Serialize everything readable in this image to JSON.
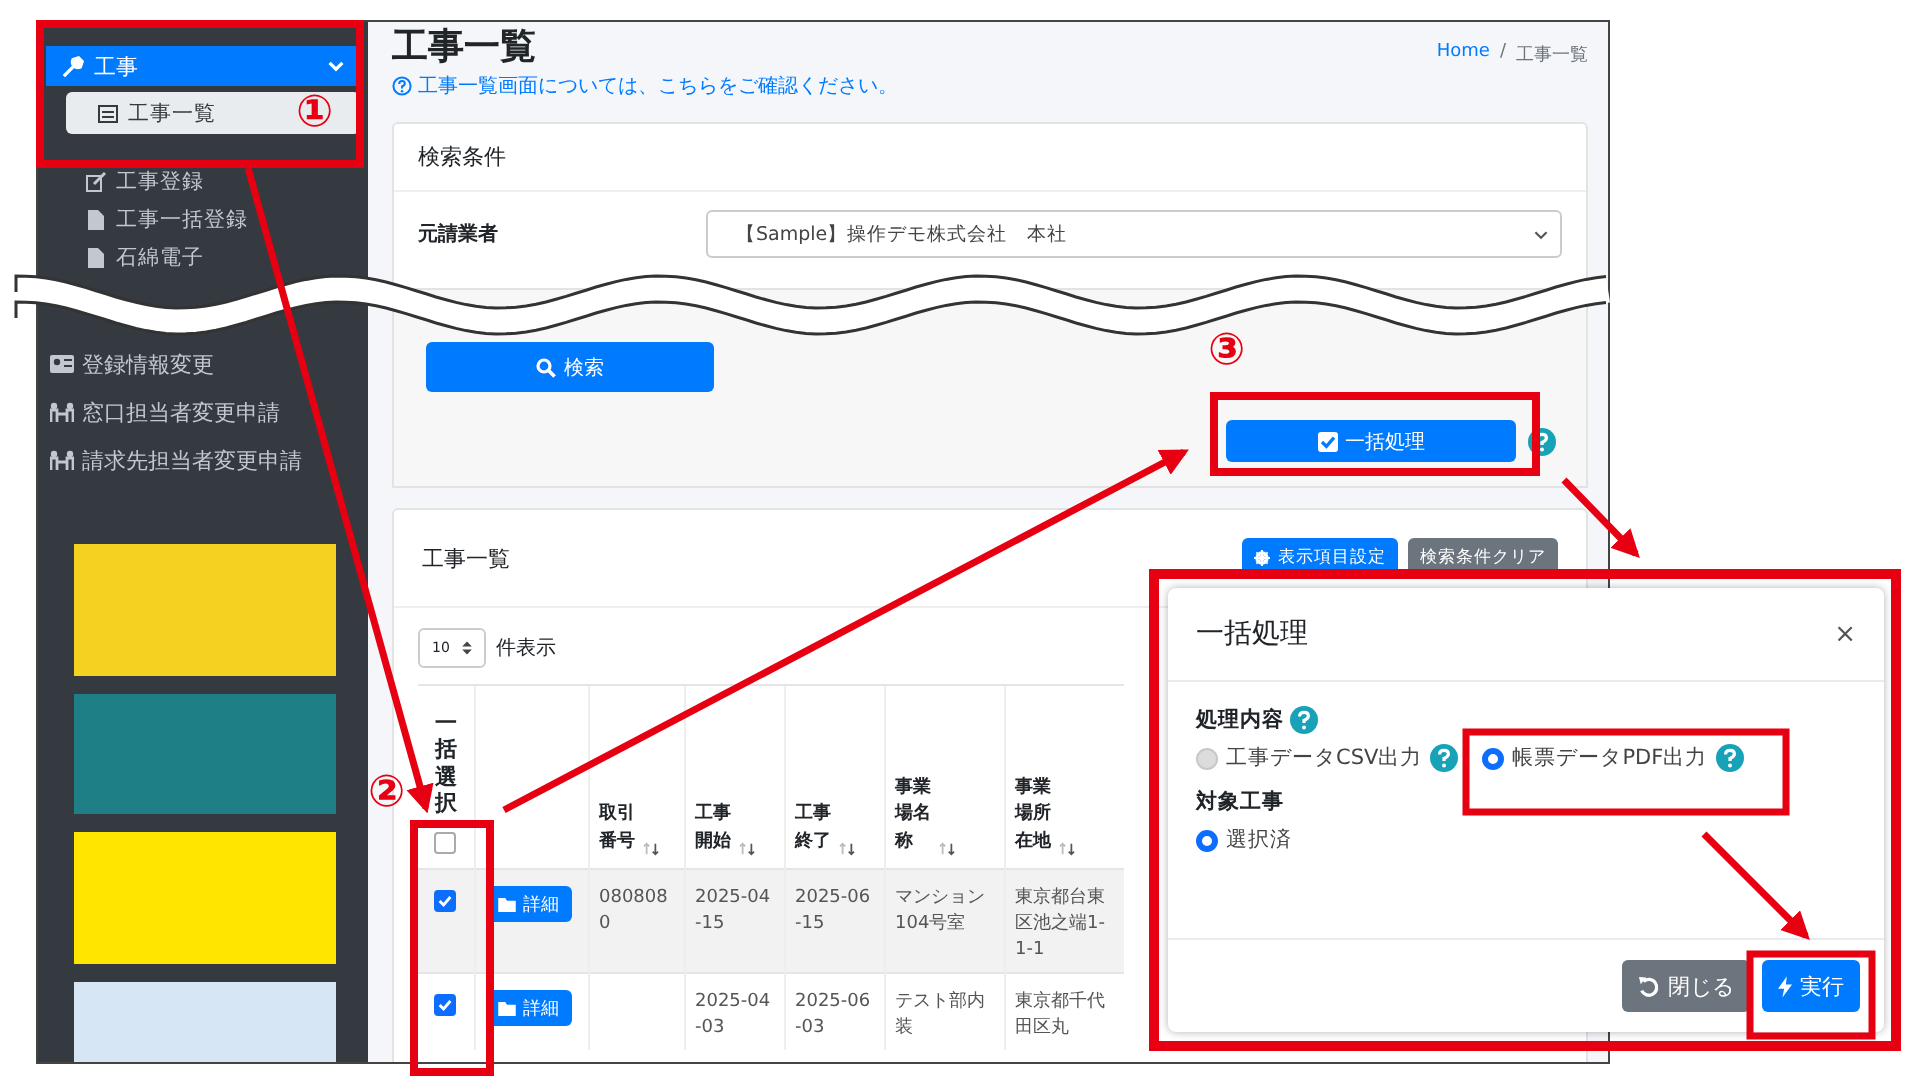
{
  "sidebar": {
    "section": {
      "label": "工事",
      "expanded": true
    },
    "sub_items": [
      {
        "label": "工事一覧",
        "selected": true
      },
      {
        "label": "工事登録",
        "selected": false
      },
      {
        "label": "工事一括登録",
        "selected": false
      },
      {
        "label": "石綿電子",
        "selected": false
      }
    ],
    "items": [
      {
        "label": "登録情報変更",
        "kind": "card"
      },
      {
        "label": "窓口担当者変更申請",
        "kind": "people"
      },
      {
        "label": "請求先担当者変更申請",
        "kind": "people"
      }
    ]
  },
  "header": {
    "title": "工事一覧",
    "breadcrumb": {
      "items": [
        "Home",
        "工事一覧"
      ],
      "separator": "/"
    },
    "help_link": "工事一覧画面については、こちらをご確認ください。"
  },
  "search": {
    "title": "検索条件",
    "fields": [
      {
        "label": "元請業者",
        "value": "【Sample】操作デモ株式会社　本社"
      }
    ],
    "button": "検索",
    "batch_button": "一括処理"
  },
  "list": {
    "title": "工事一覧",
    "buttons": [
      "表示項目設定",
      "検索条件クリア"
    ],
    "page_size": "10",
    "page_size_label": "件表示",
    "select_header": "一括選択",
    "select_all": false,
    "columns": [
      "取引番号",
      "工事開始",
      "工事終了",
      "事業場名称",
      "事業場所在地"
    ],
    "rows": [
      {
        "selected": true,
        "detail": "詳細",
        "cells": [
          "0808080",
          "2025-04-15",
          "2025-06-15",
          "マンション　104号室",
          "東京都台東区池之端1-1-1"
        ]
      },
      {
        "selected": true,
        "detail": "詳細",
        "cells": [
          null,
          "2025-04-03",
          "2025-06-03",
          "テスト部内装",
          "東京都千代田区丸"
        ]
      }
    ]
  },
  "modal": {
    "title": "一括処理",
    "close": "×",
    "sections": [
      {
        "label": "処理内容",
        "help": true,
        "options": [
          {
            "label": "工事データCSV出力",
            "selected": false,
            "help": true
          },
          {
            "label": "帳票データPDF出力",
            "selected": true,
            "help": true
          }
        ]
      },
      {
        "label": "対象工事",
        "help": false,
        "options": [
          {
            "label": "選択済",
            "selected": true,
            "help": false
          }
        ]
      }
    ],
    "buttons": [
      {
        "label": "閉じる",
        "kind": "secondary"
      },
      {
        "label": "実行",
        "kind": "primary"
      }
    ]
  },
  "annotations": {
    "markers": [
      "①",
      "②",
      "③"
    ]
  }
}
